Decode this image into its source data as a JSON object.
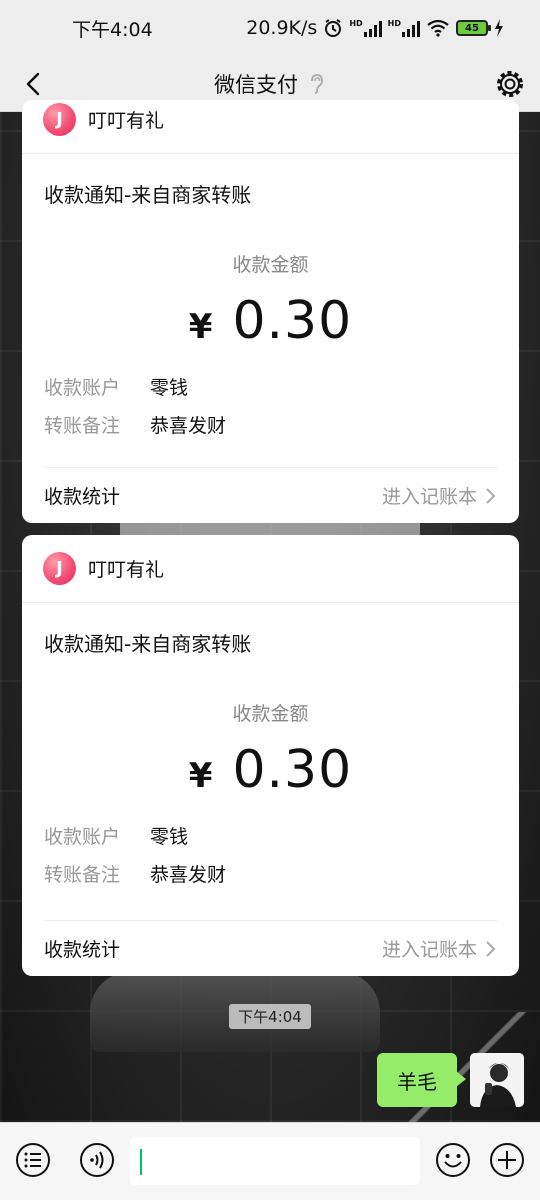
{
  "status_bar": {
    "time": "下午4:04",
    "network_speed": "20.9K/s",
    "battery": "45",
    "icons": [
      "alarm-icon",
      "signal-icon",
      "wifi-icon",
      "battery-icon",
      "charging-icon"
    ]
  },
  "nav": {
    "title": "微信支付",
    "icons": [
      "back-icon",
      "ear-icon",
      "settings-icon"
    ]
  },
  "cards": [
    {
      "brand": "叮叮有礼",
      "brand_logo_text": "J",
      "subtitle": "收款通知-来自商家转账",
      "amount_label": "收款金额",
      "currency": "¥",
      "amount": "0.30",
      "rows": [
        {
          "key": "收款账户",
          "value": "零钱"
        },
        {
          "key": "转账备注",
          "value": "恭喜发财"
        }
      ],
      "footer_left": "收款统计",
      "footer_right": "进入记账本"
    },
    {
      "brand": "叮叮有礼",
      "brand_logo_text": "J",
      "subtitle": "收款通知-来自商家转账",
      "amount_label": "收款金额",
      "currency": "¥",
      "amount": "0.30",
      "rows": [
        {
          "key": "收款账户",
          "value": "零钱"
        },
        {
          "key": "转账备注",
          "value": "恭喜发财"
        }
      ],
      "footer_left": "收款统计",
      "footer_right": "进入记账本"
    }
  ],
  "chat": {
    "timestamp": "下午4:04",
    "outgoing_message": "羊毛"
  },
  "input_bar": {
    "value": "",
    "icons": [
      "menu-icon",
      "voice-icon",
      "emoji-icon",
      "plus-icon"
    ]
  },
  "colors": {
    "bubble": "#95ec69",
    "accent": "#07c160",
    "brand_logo": "#f14b72"
  }
}
